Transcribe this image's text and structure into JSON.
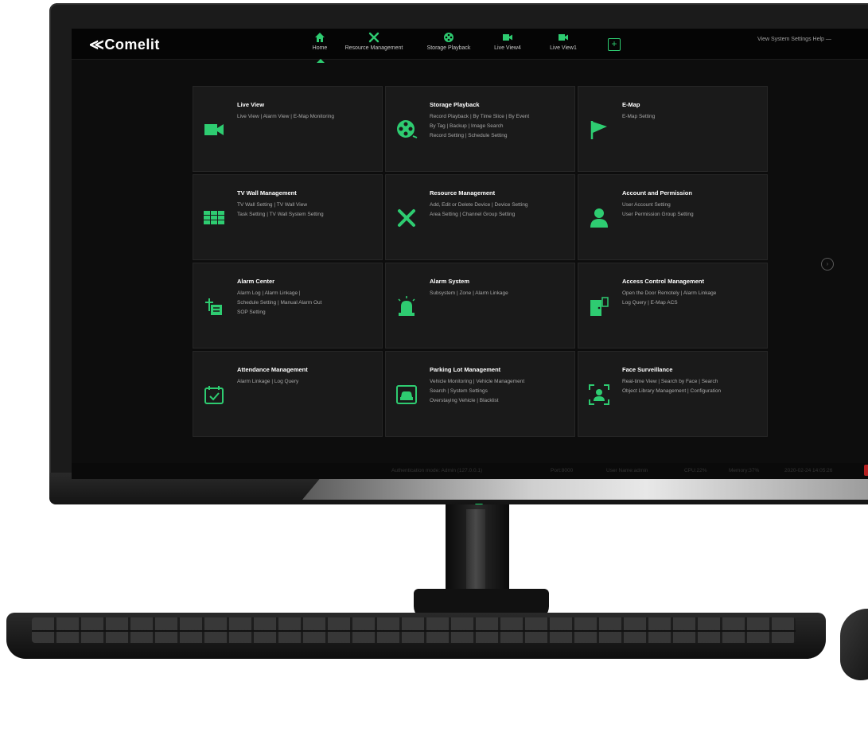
{
  "brand": {
    "logo": "≪Comelit",
    "accent_color": "#2ecc71"
  },
  "nav": {
    "items": [
      {
        "label": "Home",
        "icon": "home-icon",
        "active": true
      },
      {
        "label": "Resource Management",
        "icon": "tools-icon",
        "active": false
      },
      {
        "label": "Storage Playback",
        "icon": "film-reel-icon",
        "active": false
      },
      {
        "label": "Live View4",
        "icon": "video-camera-icon",
        "active": false
      },
      {
        "label": "Live View1",
        "icon": "video-camera-icon",
        "active": false
      }
    ],
    "add_icon": "plus-square-icon",
    "top_links": "View System Settings Help —"
  },
  "tiles": [
    {
      "title": "Live View",
      "icon": "video-camera-icon",
      "lines": [
        "Live View | Alarm View | E-Map Monitoring"
      ]
    },
    {
      "title": "Storage Playback",
      "icon": "film-reel-icon",
      "lines": [
        "Record Playback | By Time Slice | By Event",
        "By Tag | Backup | Image Search",
        "Record Setting | Schedule Setting"
      ]
    },
    {
      "title": "E-Map",
      "icon": "flag-icon",
      "lines": [
        "E-Map Setting"
      ]
    },
    {
      "title": "TV Wall Management",
      "icon": "grid-icon",
      "lines": [
        "TV Wall Setting | TV Wall View",
        "Task Setting | TV Wall System Setting"
      ]
    },
    {
      "title": "Resource Management",
      "icon": "tools-icon",
      "lines": [
        "Add, Edit or Delete Device | Device Setting",
        "Area Setting | Channel Group Setting"
      ]
    },
    {
      "title": "Account and Permission",
      "icon": "user-icon",
      "lines": [
        "User Account Setting",
        "User Permission Group Setting"
      ]
    },
    {
      "title": "Alarm Center",
      "icon": "alarm-center-icon",
      "lines": [
        "Alarm Log | Alarm Linkage |",
        "Schedule Setting | Manual Alarm Out",
        "SOP Setting"
      ]
    },
    {
      "title": "Alarm System",
      "icon": "siren-icon",
      "lines": [
        "Subsystem | Zone | Alarm Linkage"
      ]
    },
    {
      "title": "Access Control Management",
      "icon": "door-icon",
      "lines": [
        "Open the Door Remotely | Alarm Linkage",
        "Log Query | E-Map ACS"
      ]
    },
    {
      "title": "Attendance Management",
      "icon": "calendar-check-icon",
      "lines": [
        "Alarm Linkage | Log Query"
      ]
    },
    {
      "title": "Parking Lot Management",
      "icon": "car-icon",
      "lines": [
        "Vehicle Monitoring | Vehicle Management",
        "Search | System Settings",
        "Overstaying Vehicle | Blacklist"
      ]
    },
    {
      "title": "Face Surveillance",
      "icon": "face-scan-icon",
      "lines": [
        "Real-time View | Search by Face | Search",
        "Object Library Management | Configuration"
      ]
    }
  ],
  "side_button_icon": "next-page-icon",
  "status": {
    "authentication": "Authentication mode: Admin (127.0.0.1)",
    "port": "Port:8000",
    "user": "User Name:admin",
    "cpu": "CPU:22%",
    "memory": "Memory:37%",
    "datetime": "2020-02-24 14:05:26"
  }
}
